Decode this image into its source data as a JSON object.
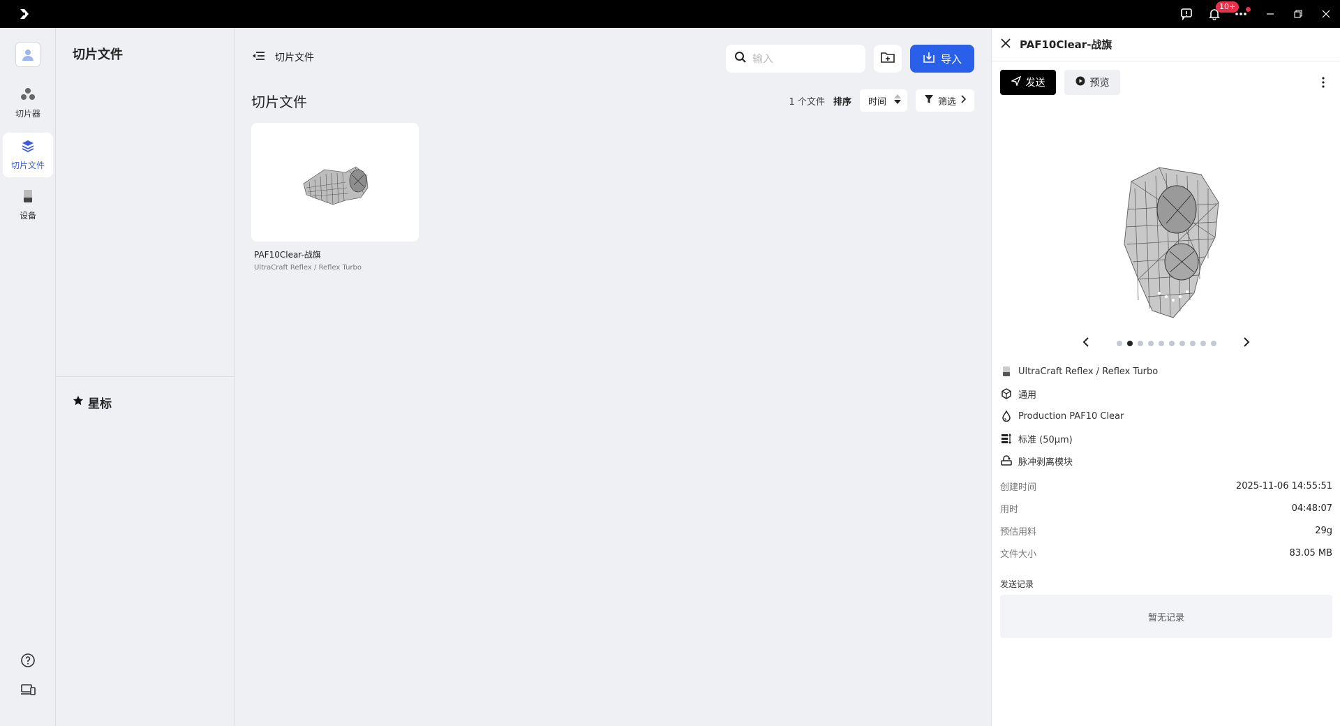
{
  "titlebar": {
    "notification_badge": "10+",
    "icons": [
      "app-logo-icon",
      "feedback-icon",
      "bell-icon",
      "more-icon",
      "minimize-icon",
      "restore-icon",
      "close-icon"
    ]
  },
  "rail": {
    "items": [
      {
        "label": "切片器",
        "icon": "slicer-icon"
      },
      {
        "label": "切片文件",
        "icon": "layers-icon"
      },
      {
        "label": "设备",
        "icon": "printer-icon"
      }
    ]
  },
  "sidebar": {
    "title": "切片文件",
    "starred_label": "星标"
  },
  "main": {
    "breadcrumb": "切片文件",
    "search_placeholder": "输入",
    "import_label": "导入",
    "page_title": "切片文件",
    "file_count": "1 个文件",
    "sort_label": "排序",
    "sort_value": "时间",
    "filter_label": "筛选",
    "files": [
      {
        "name": "PAF10Clear-战旗",
        "printer": "UltraCraft Reflex / Reflex Turbo"
      }
    ]
  },
  "detail": {
    "title": "PAF10Clear-战旗",
    "send_label": "发送",
    "preview_label": "预览",
    "carousel_total": 10,
    "carousel_active": 1,
    "specs": [
      {
        "icon": "printer-icon",
        "text": "UltraCraft Reflex / Reflex Turbo"
      },
      {
        "icon": "cube-icon",
        "text": "通用"
      },
      {
        "icon": "drop-icon",
        "text": "Production PAF10 Clear"
      },
      {
        "icon": "layer-height-icon",
        "text": "标准 (50μm)"
      },
      {
        "icon": "peel-module-icon",
        "text": "脉冲剥离模块"
      }
    ],
    "stats": [
      {
        "key": "创建时间",
        "value": "2025-11-06 14:55:51"
      },
      {
        "key": "用时",
        "value": "04:48:07"
      },
      {
        "key": "预估用料",
        "value": "29g"
      },
      {
        "key": "文件大小",
        "value": "83.05 MB"
      }
    ],
    "log_label": "发送记录",
    "log_empty": "暂无记录"
  },
  "colors": {
    "accent": "#2a5fe9",
    "active_nav": "#3b5bdb",
    "badge": "#e8304b"
  }
}
